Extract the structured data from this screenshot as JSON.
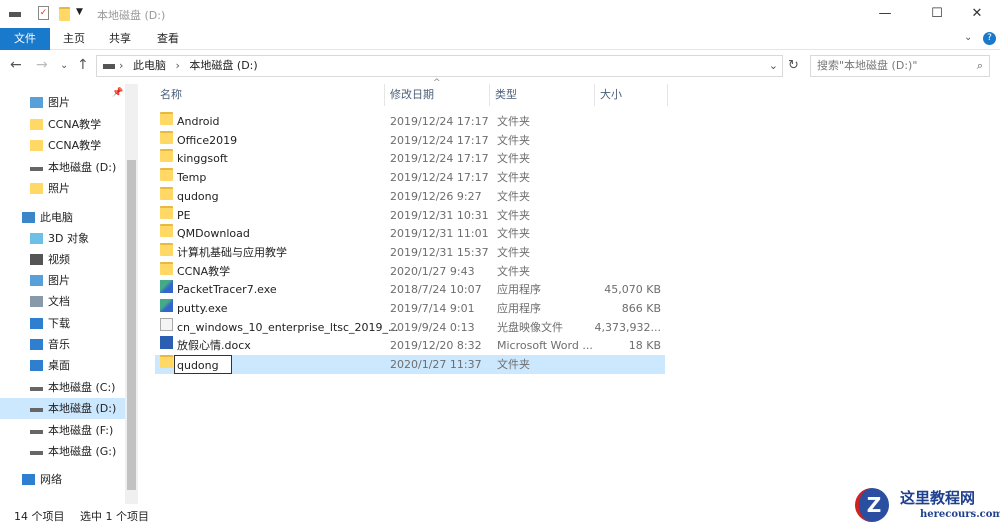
{
  "window": {
    "title": "本地磁盘 (D:)"
  },
  "ribbon": {
    "tabs": [
      "文件",
      "主页",
      "共享",
      "查看"
    ]
  },
  "address": {
    "crumbs": [
      "此电脑",
      "本地磁盘 (D:)"
    ],
    "search_placeholder": "搜索\"本地磁盘 (D:)\""
  },
  "sidebar": {
    "items": [
      {
        "label": "图片",
        "icon": "pictures-icon"
      },
      {
        "label": "CCNA教学",
        "icon": "folder-icon"
      },
      {
        "label": "CCNA教学",
        "icon": "folder-icon"
      },
      {
        "label": "本地磁盘 (D:)",
        "icon": "drive-icon"
      },
      {
        "label": "照片",
        "icon": "folder-icon"
      },
      {
        "label": "此电脑",
        "icon": "computer-icon"
      },
      {
        "label": "3D 对象",
        "icon": "3d-objects-icon"
      },
      {
        "label": "视频",
        "icon": "videos-icon"
      },
      {
        "label": "图片",
        "icon": "pictures-icon"
      },
      {
        "label": "文档",
        "icon": "documents-icon"
      },
      {
        "label": "下载",
        "icon": "downloads-icon"
      },
      {
        "label": "音乐",
        "icon": "music-icon"
      },
      {
        "label": "桌面",
        "icon": "desktop-icon"
      },
      {
        "label": "本地磁盘 (C:)",
        "icon": "drive-icon"
      },
      {
        "label": "本地磁盘 (D:)",
        "icon": "drive-icon"
      },
      {
        "label": "本地磁盘 (F:)",
        "icon": "drive-icon"
      },
      {
        "label": "本地磁盘 (G:)",
        "icon": "drive-icon"
      },
      {
        "label": "网络",
        "icon": "network-icon"
      }
    ]
  },
  "columns": [
    "名称",
    "修改日期",
    "类型",
    "大小"
  ],
  "files": [
    {
      "name": "Android",
      "date": "2019/12/24 17:17",
      "type": "文件夹",
      "size": ""
    },
    {
      "name": "Office2019",
      "date": "2019/12/24 17:17",
      "type": "文件夹",
      "size": ""
    },
    {
      "name": "kinggsoft",
      "date": "2019/12/24 17:17",
      "type": "文件夹",
      "size": ""
    },
    {
      "name": "Temp",
      "date": "2019/12/24 17:17",
      "type": "文件夹",
      "size": ""
    },
    {
      "name": "qudong",
      "date": "2019/12/26 9:27",
      "type": "文件夹",
      "size": ""
    },
    {
      "name": "PE",
      "date": "2019/12/31 10:31",
      "type": "文件夹",
      "size": ""
    },
    {
      "name": "QMDownload",
      "date": "2019/12/31 11:01",
      "type": "文件夹",
      "size": ""
    },
    {
      "name": "计算机基础与应用教学",
      "date": "2019/12/31 15:37",
      "type": "文件夹",
      "size": ""
    },
    {
      "name": "CCNA教学",
      "date": "2020/1/27 9:43",
      "type": "文件夹",
      "size": ""
    },
    {
      "name": "PacketTracer7.exe",
      "date": "2018/7/24 10:07",
      "type": "应用程序",
      "size": "45,070 KB"
    },
    {
      "name": "putty.exe",
      "date": "2019/7/14 9:01",
      "type": "应用程序",
      "size": "866 KB"
    },
    {
      "name": "cn_windows_10_enterprise_ltsc_2019_...",
      "date": "2019/9/24 0:13",
      "type": "光盘映像文件",
      "size": "4,373,932..."
    },
    {
      "name": "放假心情.docx",
      "date": "2019/12/20 8:32",
      "type": "Microsoft Word ...",
      "size": "18 KB"
    },
    {
      "name": "qudong",
      "date": "2020/1/27 11:37",
      "type": "文件夹",
      "size": ""
    }
  ],
  "status": {
    "count": "14 个项目",
    "selected": "选中 1 个项目"
  },
  "watermark": {
    "title": "这里教程网",
    "url": "herecours.com"
  }
}
